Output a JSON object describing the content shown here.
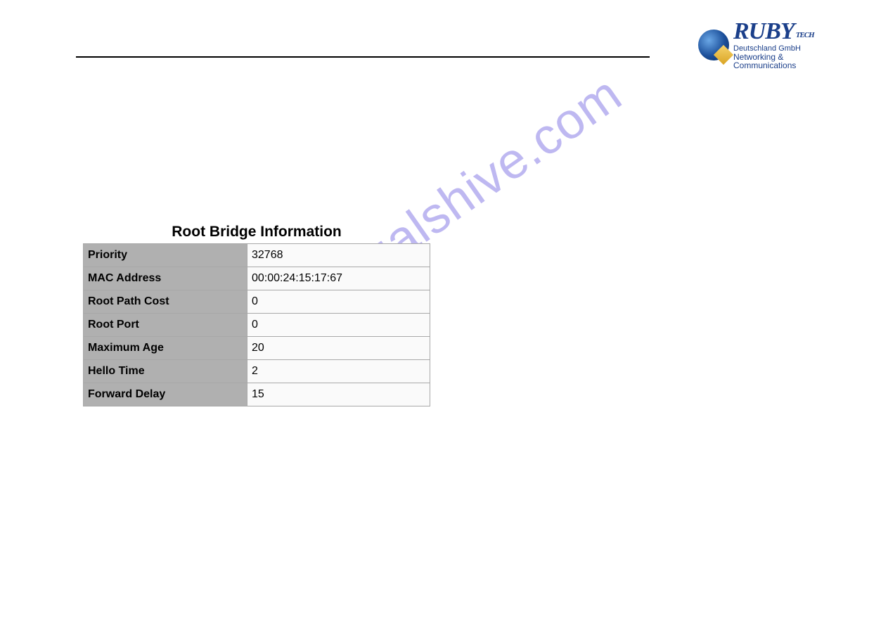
{
  "logo": {
    "brand": "RUBY",
    "suffix": "TECH",
    "line1": "Deutschland GmbH",
    "line2": "Networking & Communications"
  },
  "watermark": "manualshive.com",
  "table": {
    "title": "Root Bridge Information",
    "rows": [
      {
        "label": "Priority",
        "value": "32768"
      },
      {
        "label": "MAC Address",
        "value": "00:00:24:15:17:67"
      },
      {
        "label": "Root Path Cost",
        "value": "0"
      },
      {
        "label": "Root Port",
        "value": "0"
      },
      {
        "label": "Maximum Age",
        "value": "20"
      },
      {
        "label": "Hello Time",
        "value": "2"
      },
      {
        "label": "Forward Delay",
        "value": "15"
      }
    ]
  }
}
